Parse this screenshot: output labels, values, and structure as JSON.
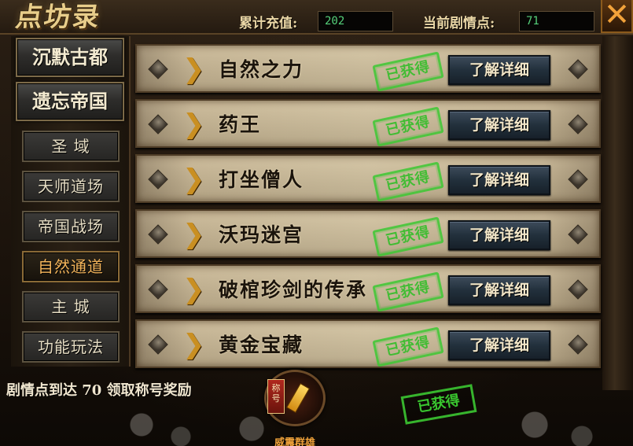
{
  "header": {
    "logo": "点坊录",
    "recharge_label": "累计充值:",
    "recharge_value": "202",
    "story_label": "当前剧情点:",
    "story_value": "71",
    "close_symbol": "✕"
  },
  "nav": {
    "main": [
      "沉默古都",
      "遗忘帝国"
    ],
    "sub": [
      "圣  域",
      "天师道场",
      "帝国战场",
      "自然通道",
      "主  城",
      "功能玩法"
    ],
    "active_sub": "自然通道"
  },
  "rows": [
    {
      "title": "自然之力",
      "stamp": "已获得",
      "button": "了解详细"
    },
    {
      "title": "药王",
      "stamp": "已获得",
      "button": "了解详细"
    },
    {
      "title": "打坐僧人",
      "stamp": "已获得",
      "button": "了解详细"
    },
    {
      "title": "沃玛迷宫",
      "stamp": "已获得",
      "button": "了解详细"
    },
    {
      "title": "破棺珍剑的传承",
      "stamp": "已获得",
      "button": "了解详细"
    },
    {
      "title": "黄金宝藏",
      "stamp": "已获得",
      "button": "了解详细"
    }
  ],
  "footer": {
    "reward_text": "剧情点到达 70 领取称号奖励",
    "badge_tag": "称号",
    "reward_name": "威震群雄",
    "stamp": "已获得"
  },
  "colors": {
    "accent_gold": "#e8cd8a",
    "value_green": "#55d07a",
    "stamp_green": "#3cc832",
    "active_nav": "#f2b35a"
  }
}
